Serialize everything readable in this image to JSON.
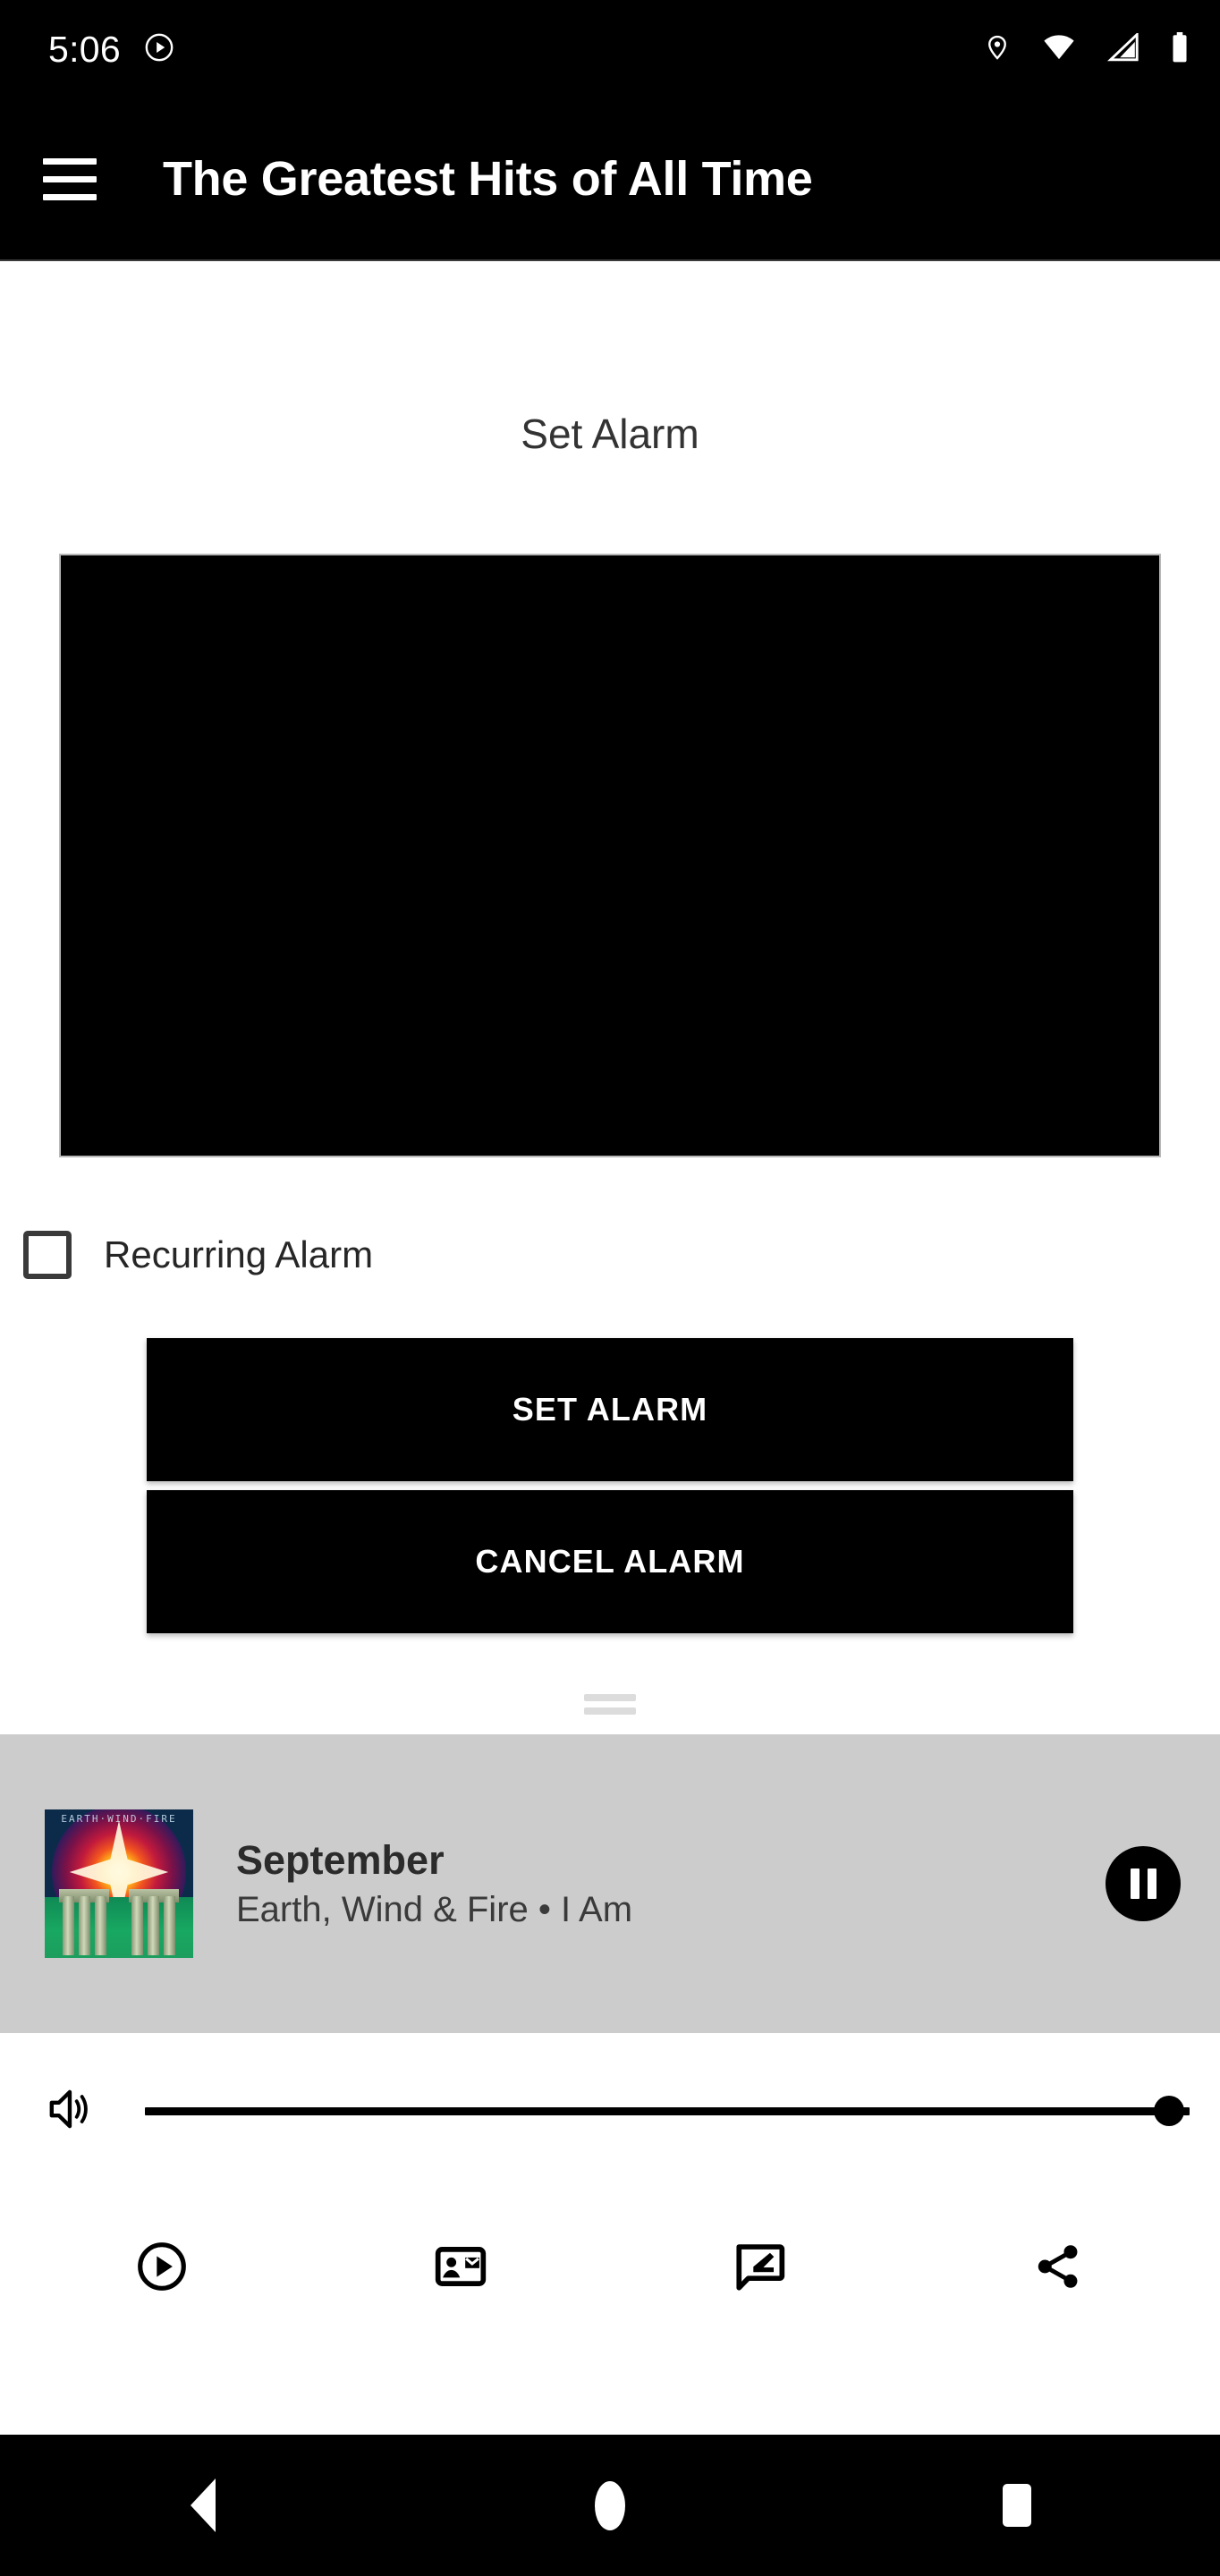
{
  "status_bar": {
    "clock": "5:06",
    "left_icons": [
      "play-circle-icon"
    ],
    "right_icons": [
      "location-pin-icon",
      "wifi-icon",
      "cellular-signal-icon",
      "battery-icon"
    ]
  },
  "app_bar": {
    "menu_icon": "hamburger-menu-icon",
    "title": "The Greatest Hits of All Time"
  },
  "main": {
    "section_title": "Set Alarm",
    "time_picker": {
      "name": "time-picker",
      "value": ""
    },
    "recurring_checkbox": {
      "label": "Recurring Alarm",
      "checked": false
    },
    "buttons": {
      "set_alarm": "SET ALARM",
      "cancel_alarm": "CANCEL ALARM"
    },
    "drag_handle": "bottom-sheet-drag-handle"
  },
  "mini_player": {
    "album_art_alt": "I Am album cover",
    "album_art_band_text": "EARTH·WIND·FIRE",
    "track_title": "September",
    "track_subtitle": "Earth, Wind & Fire • I Am",
    "play_pause_state": "pause-icon",
    "background_color": "#cccccc"
  },
  "volume": {
    "icon": "volume-up-icon",
    "value": 100,
    "min": 0,
    "max": 100
  },
  "action_bar": {
    "items": [
      {
        "name": "play-circle-outline-icon",
        "label": "Play"
      },
      {
        "name": "contact-mail-icon",
        "label": "Contact"
      },
      {
        "name": "rate-review-icon",
        "label": "Review"
      },
      {
        "name": "share-icon",
        "label": "Share"
      }
    ]
  },
  "nav_bar": {
    "items": [
      {
        "name": "nav-back-button",
        "label": "Back"
      },
      {
        "name": "nav-home-button",
        "label": "Home"
      },
      {
        "name": "nav-recents-button",
        "label": "Recents"
      }
    ]
  },
  "colors": {
    "app_bar_bg": "#000000",
    "body_bg": "#ffffff",
    "button_bg": "#000000",
    "player_bg": "#cccccc"
  }
}
